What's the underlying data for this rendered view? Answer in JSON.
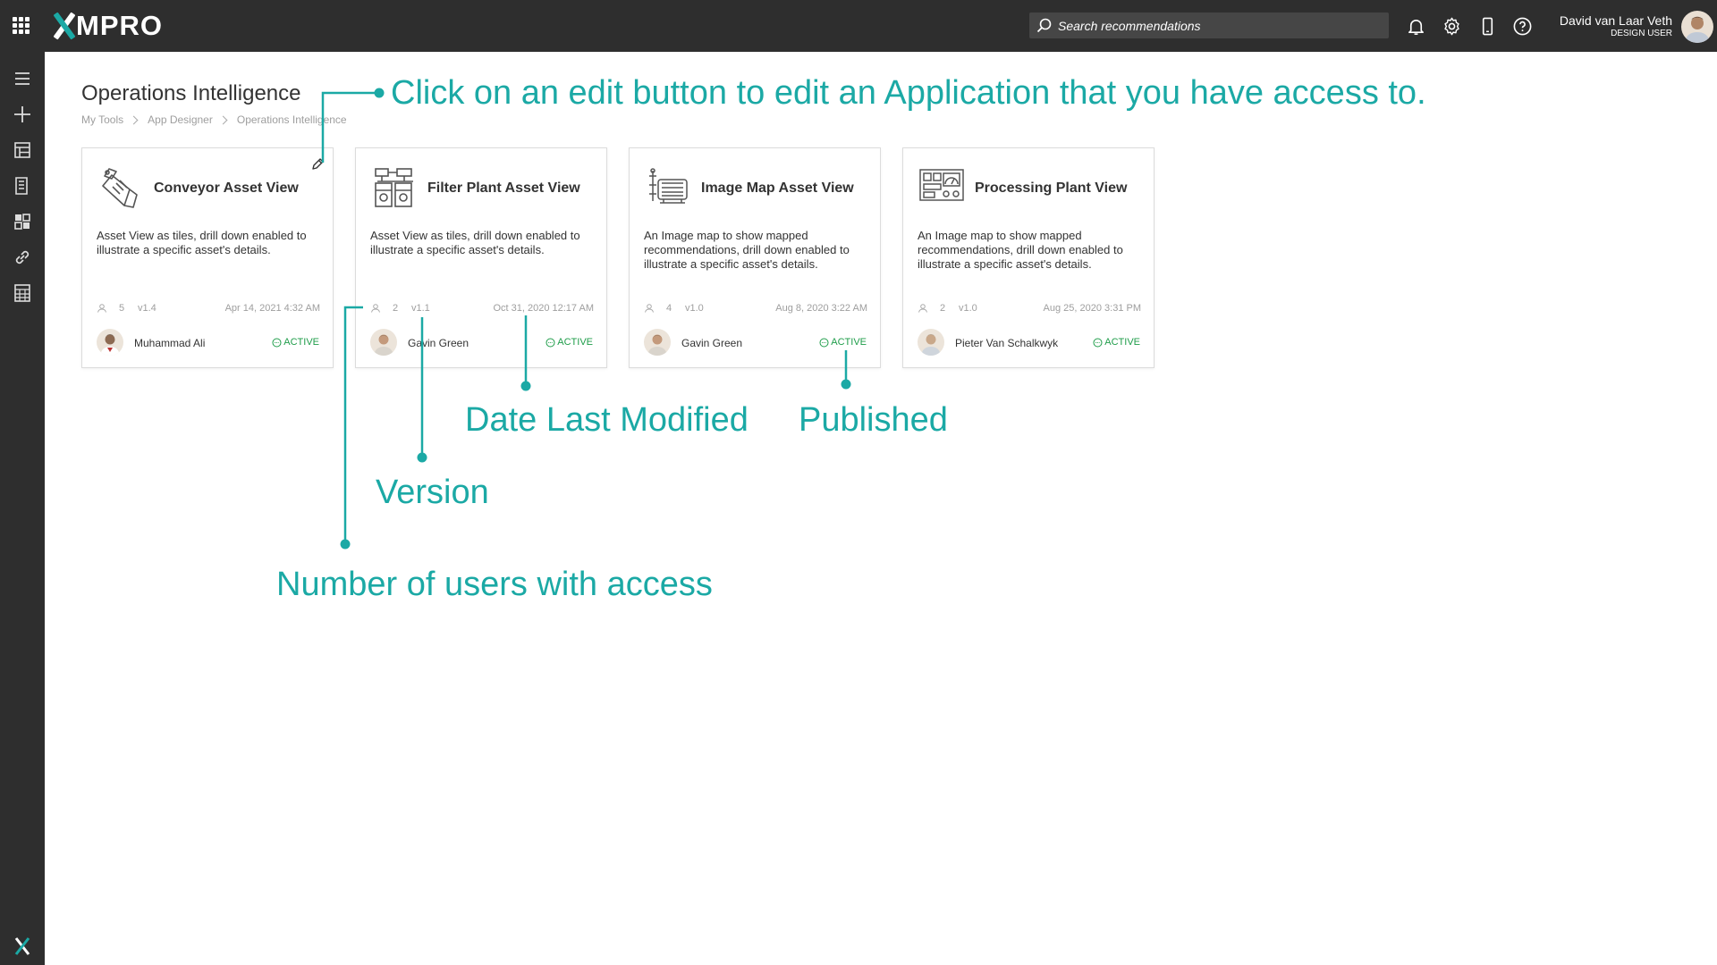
{
  "topbar": {
    "brand": "XMPRO",
    "search_placeholder": "Search recommendations",
    "user_name": "David van Laar Veth",
    "user_role": "DESIGN USER",
    "accent": "#1ba9a5",
    "background": "#2e2e2e"
  },
  "topbar_icons": [
    "bell-icon",
    "gear-icon",
    "mobile-icon",
    "help-icon"
  ],
  "sidebar_icons": [
    "menu-icon",
    "add-icon",
    "dashboard-icon",
    "document-icon",
    "apps-icon",
    "link-icon",
    "calculator-icon",
    "xmpro-x-icon"
  ],
  "page": {
    "title": "Operations Intelligence",
    "breadcrumb": [
      "My Tools",
      "App Designer",
      "Operations Intelligence"
    ]
  },
  "cards": [
    {
      "title": "Conveyor Asset View",
      "description": "Asset View as tiles, drill down enabled to illustrate a specific asset's details.",
      "users": "5",
      "version": "v1.4",
      "date": "Apr 14, 2021 4:32 AM",
      "author": "Muhammad Ali",
      "status": "ACTIVE",
      "icon": "conveyor-icon"
    },
    {
      "title": "Filter Plant Asset View",
      "description": "Asset View as tiles, drill down enabled to illustrate a specific asset's details.",
      "users": "2",
      "version": "v1.1",
      "date": "Oct 31, 2020 12:17 AM",
      "author": "Gavin Green",
      "status": "ACTIVE",
      "icon": "filter-plant-icon"
    },
    {
      "title": "Image Map Asset View",
      "description": "An Image map to show mapped recommendations, drill down enabled to illustrate a specific asset's details.",
      "users": "4",
      "version": "v1.0",
      "date": "Aug 8, 2020 3:22 AM",
      "author": "Gavin Green",
      "status": "ACTIVE",
      "icon": "image-map-icon"
    },
    {
      "title": "Processing Plant View",
      "description": "An Image map to show mapped recommendations, drill down enabled to illustrate a specific asset's details.",
      "users": "2",
      "version": "v1.0",
      "date": "Aug 25, 2020 3:31 PM",
      "author": "Pieter Van Schalkwyk",
      "status": "ACTIVE",
      "icon": "processing-plant-icon"
    }
  ],
  "status_color": "#1f9d4a",
  "annotations": {
    "edit": "Click on an edit button to edit an Application that you have access to.",
    "date": "Date Last Modified",
    "published": "Published",
    "version": "Version",
    "users": "Number of users with access"
  }
}
